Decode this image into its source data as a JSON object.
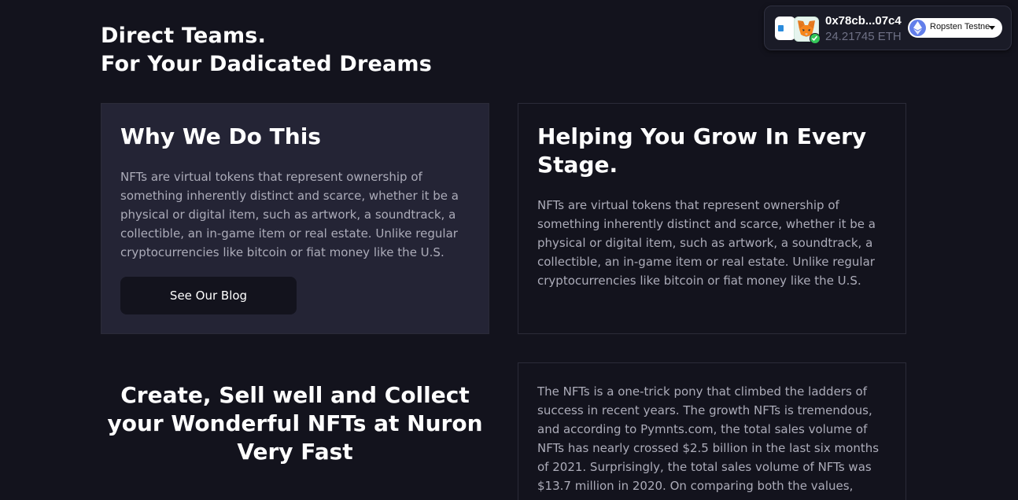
{
  "hero": {
    "line1": "Direct Teams.",
    "line2": "For Your Dadicated Dreams"
  },
  "why_card": {
    "title": "Why We Do This",
    "body": "NFTs are virtual tokens that represent ownership of something inherently distinct and scarce, whether it be a physical or digital item, such as artwork, a soundtrack, a collectible, an in-game item or real estate. Unlike regular cryptocurrencies like bitcoin or fiat money like the U.S.",
    "button_label": "See Our Blog"
  },
  "grow_card": {
    "title": "Helping You Grow In Every Stage.",
    "body": "NFTs are virtual tokens that represent ownership of something inherently distinct and scarce, whether it be a physical or digital item, such as artwork, a soundtrack, a collectible, an in-game item or real estate. Unlike regular cryptocurrencies like bitcoin or fiat money like the U.S."
  },
  "create_section": {
    "title": "Create, Sell well and Collect your Wonderful NFTs at Nuron Very Fast",
    "body": "The NFTs is a one-trick pony that climbed the ladders of success in recent years. The growth NFTs is tremendous, and according to Pymnts.com, the total sales volume of NFTs has nearly crossed $2.5 billion in the last six months of 2021. Surprisingly, the total sales volume of NFTs was $13.7 million in 2020. On comparing both the values,"
  },
  "wallet": {
    "address": "0x78cb...07c4",
    "balance": "24.21745 ETH",
    "network": "Ropsten Testnet",
    "icons": [
      "wallet-app-icon",
      "metamask-fox-icon",
      "check-icon",
      "ethereum-icon",
      "chevron-down-icon"
    ]
  },
  "colors": {
    "background": "#13131d",
    "card_highlight": "#242435",
    "body_text": "#acacb9",
    "status_green": "#34c759",
    "eth_blue": "#627eea"
  }
}
